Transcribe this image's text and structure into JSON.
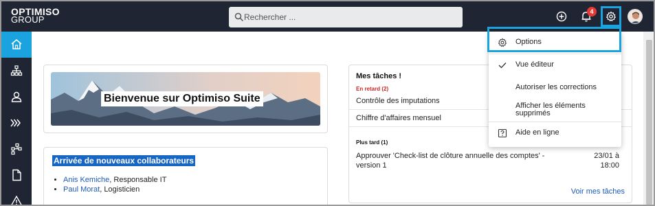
{
  "brand": {
    "line1": "OPTIMISO",
    "line2": "GROUP"
  },
  "search": {
    "placeholder": "Rechercher ..."
  },
  "notifications": {
    "count": "4"
  },
  "sidebar": {
    "items": [
      "home",
      "org-chart",
      "user",
      "process",
      "hierarchy",
      "document",
      "warning"
    ]
  },
  "banner": {
    "title": "Bienvenue sur Optimiso Suite"
  },
  "arrivals": {
    "title": "Arrivée de nouveaux collaborateurs",
    "people": [
      {
        "name": "Anis Kemiche",
        "role": ", Responsable IT"
      },
      {
        "name": "Paul Morat",
        "role": ", Logisticien"
      }
    ]
  },
  "tasks": {
    "title": "Mes tâches !",
    "late": {
      "label": "En retard",
      "count": "(2)",
      "items": [
        "Contrôle des imputations",
        "Chiffre d'affaires mensuel"
      ]
    },
    "later": {
      "label": "Plus tard",
      "count": "(1)",
      "item": "Approuver 'Check-list de clôture annuelle des comptes' - version 1",
      "date": "23/01 à 18:00"
    },
    "link": "Voir mes tâches"
  },
  "menu": {
    "options": "Options",
    "editor_view": "Vue éditeur",
    "allow_corrections": "Autoriser les corrections",
    "show_deleted": "Afficher les éléments supprimés",
    "online_help": "Aide en ligne"
  },
  "colors": {
    "accent": "#1aa3df",
    "topbar": "#1f2533",
    "late": "#c62828",
    "link": "#1d5bb8"
  }
}
